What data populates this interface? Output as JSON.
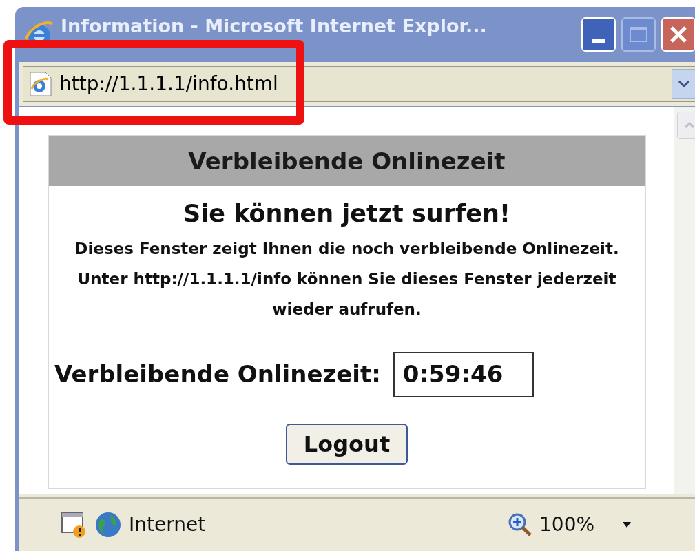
{
  "window": {
    "title": "Information - Microsoft Internet Explor..."
  },
  "address_bar": {
    "url": "http://1.1.1.1/info.html"
  },
  "page": {
    "header": "Verbleibende Onlinezeit",
    "heading": "Sie können jetzt surfen!",
    "message": "Dieses Fenster zeigt Ihnen die noch verbleibende Onlinezeit. Unter http://1.1.1.1/info können Sie dieses Fenster jederzeit wieder aufrufen.",
    "timer_label": "Verbleibende Onlinezeit:",
    "timer_value": "0:59:46",
    "button": "Logout"
  },
  "status_bar": {
    "zone": "Internet",
    "zoom": "100%"
  }
}
